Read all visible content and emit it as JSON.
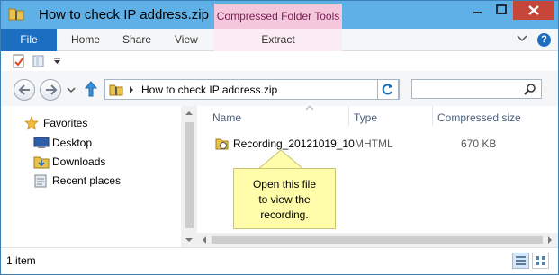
{
  "window": {
    "title": "How to check IP address.zip",
    "context_tab": "Compressed Folder Tools"
  },
  "ribbon": {
    "file": "File",
    "home": "Home",
    "share": "Share",
    "view": "View",
    "extract": "Extract"
  },
  "address": {
    "path": "How to check IP address.zip"
  },
  "navigation": {
    "favorites": "Favorites",
    "items": [
      "Desktop",
      "Downloads",
      "Recent places"
    ]
  },
  "columns": {
    "name": "Name",
    "type": "Type",
    "size": "Compressed size"
  },
  "files": [
    {
      "name": "Recording_20121019_10",
      "type": "MHTML",
      "size": "670 KB"
    }
  ],
  "callout": {
    "line1": "Open this file",
    "line2": "to view the",
    "line3": "recording."
  },
  "status": {
    "count": "1 item"
  },
  "colors": {
    "titlebar": "#5fb0e6",
    "file_tab": "#1c6fc0",
    "context_tab": "#f4c7dd",
    "close_button": "#c7463a",
    "callout": "#fffcaa"
  }
}
